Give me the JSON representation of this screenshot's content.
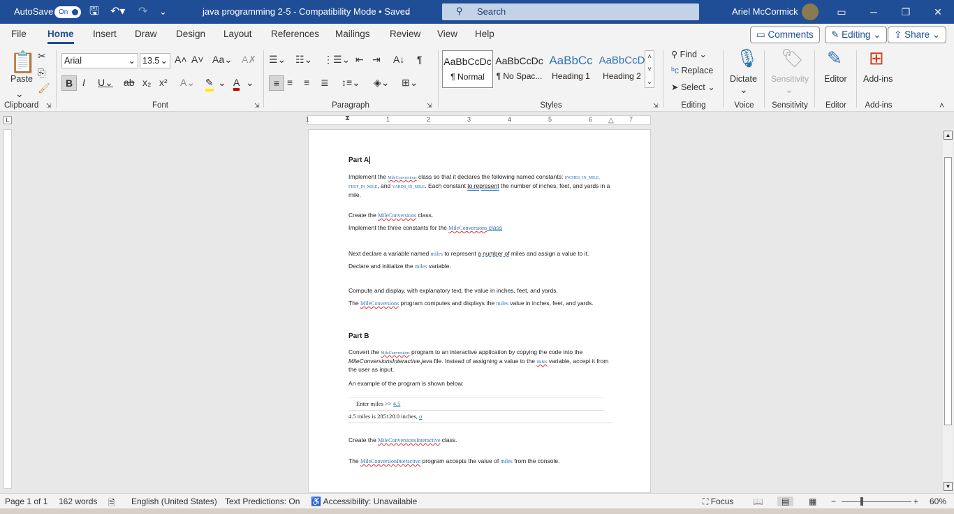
{
  "titlebar": {
    "autosave": "AutoSave",
    "toggle": "On",
    "doc_title": "java programming 2-5  -  Compatibility Mode • Saved",
    "search": "Search",
    "user": "Ariel McCormick"
  },
  "menu": {
    "file": "File",
    "home": "Home",
    "insert": "Insert",
    "draw": "Draw",
    "design": "Design",
    "layout": "Layout",
    "references": "References",
    "mailings": "Mailings",
    "review": "Review",
    "view": "View",
    "help": "Help",
    "comments": "Comments",
    "editing": "Editing",
    "share": "Share"
  },
  "ribbon": {
    "clipboard": {
      "label": "Clipboard",
      "paste": "Paste"
    },
    "font": {
      "label": "Font",
      "name": "Arial",
      "size": "13.5"
    },
    "paragraph": {
      "label": "Paragraph"
    },
    "styles": {
      "label": "Styles",
      "items": [
        {
          "preview": "AaBbCcDc",
          "name": "¶ Normal"
        },
        {
          "preview": "AaBbCcDc",
          "name": "¶ No Spac..."
        },
        {
          "preview": "AaBbCc",
          "name": "Heading 1"
        },
        {
          "preview": "AaBbCcD",
          "name": "Heading 2"
        }
      ]
    },
    "editing": {
      "label": "Editing",
      "find": "Find",
      "replace": "Replace",
      "select": "Select"
    },
    "voice": {
      "label": "Voice",
      "dictate": "Dictate"
    },
    "sensitivity": {
      "label": "Sensitivity",
      "button": "Sensitivity"
    },
    "editor": {
      "label": "Editor",
      "button": "Editor"
    },
    "addins": {
      "label": "Add-ins",
      "button": "Add-ins"
    }
  },
  "ruler": {
    "n1": "1",
    "n2": "1",
    "n3": "2",
    "n4": "3",
    "n5": "4",
    "n6": "5",
    "n7": "6",
    "n8": "7"
  },
  "doc": {
    "partA": "Part A",
    "p1a": "Implement the ",
    "mc": "MileConversions",
    "p1b": " class so that it declares the following named constants: ",
    "c1": "INCHES_IN_MILE",
    "comma": ", ",
    "c2": "FEET_IN_MILE",
    "and": ", and ",
    "c3": "YARDS_IN_MILE",
    "p1c": ". Each constant ",
    "p1d": "to represent",
    "p1e": " the number of inches, feet, and yards in a mile.",
    "p2a": "Create the ",
    "p2b": " class.",
    "p3a": "Implement the three constants for the ",
    "p3b": " class",
    "p4a": "Next declare a variable named ",
    "miles": "miles",
    "p4b": " to represent ",
    "p4c": "a number of",
    "p4d": " miles and assign a value to it.",
    "p5a": "Declare and initialize the ",
    "p5b": " variable.",
    "p6": "Compute and display, with explanatory text, the value in inches, feet, and yards.",
    "p7a": "The ",
    "p7b": " program computes and displays the ",
    "p7c": " value in inches, feet, and yards.",
    "partB": "Part B",
    "p8a": "Convert the ",
    "p8b": " program to an interactive application by copying the code into the ",
    "p8c": "MileConversionsInteractive.java",
    "p8d": " file. Instead of assigning a value to the ",
    "p8e": " variable, accept it from the user as input.",
    "p9": "An example of the program is shown below:",
    "code1a": "Enter miles >> ",
    "code1b": "4.5",
    "code2a": "4.5 miles is 285120.0 inches, ",
    "code2b": "o",
    "p10a": "Create the ",
    "mci": "MileConversionsInteractive",
    "p10b": " class.",
    "p11a": "The ",
    "mcni": "MileConversionInteractive",
    "p11b": " program accepts the value of ",
    "p11c": " from the console."
  },
  "status": {
    "page": "Page 1 of 1",
    "words": "162 words",
    "language": "English (United States)",
    "predictions": "Text Predictions: On",
    "accessibility": "Accessibility: Unavailable",
    "focus": "Focus",
    "zoom": "60%"
  }
}
